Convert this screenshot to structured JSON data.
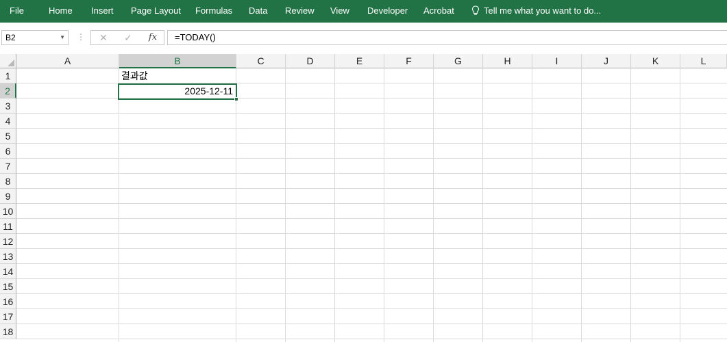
{
  "ribbon": {
    "tabs": [
      {
        "label": "File"
      },
      {
        "label": "Home"
      },
      {
        "label": "Insert"
      },
      {
        "label": "Page Layout"
      },
      {
        "label": "Formulas"
      },
      {
        "label": "Data"
      },
      {
        "label": "Review"
      },
      {
        "label": "View"
      },
      {
        "label": "Developer"
      },
      {
        "label": "Acrobat"
      }
    ],
    "tell_me": "Tell me what you want to do...",
    "tell_me_icon": "lightbulb-icon"
  },
  "formula_bar": {
    "name_box": "B2",
    "cancel_icon": "close-icon",
    "enter_icon": "check-icon",
    "fx_label": "fx",
    "formula": "=TODAY()"
  },
  "sheet": {
    "columns": [
      "A",
      "B",
      "C",
      "D",
      "E",
      "F",
      "G",
      "H",
      "I",
      "J",
      "K",
      "L"
    ],
    "rows": [
      "1",
      "2",
      "3",
      "4",
      "5",
      "6",
      "7",
      "8",
      "9",
      "10",
      "11",
      "12",
      "13",
      "14",
      "15",
      "16",
      "17",
      "18"
    ],
    "selected_column": "B",
    "selected_row": "2",
    "cells": {
      "B1": "결과값",
      "B2": "2025-12-11"
    }
  },
  "colors": {
    "accent": "#217346",
    "header_bg": "#f3f3f3",
    "gridline": "#dadada"
  }
}
